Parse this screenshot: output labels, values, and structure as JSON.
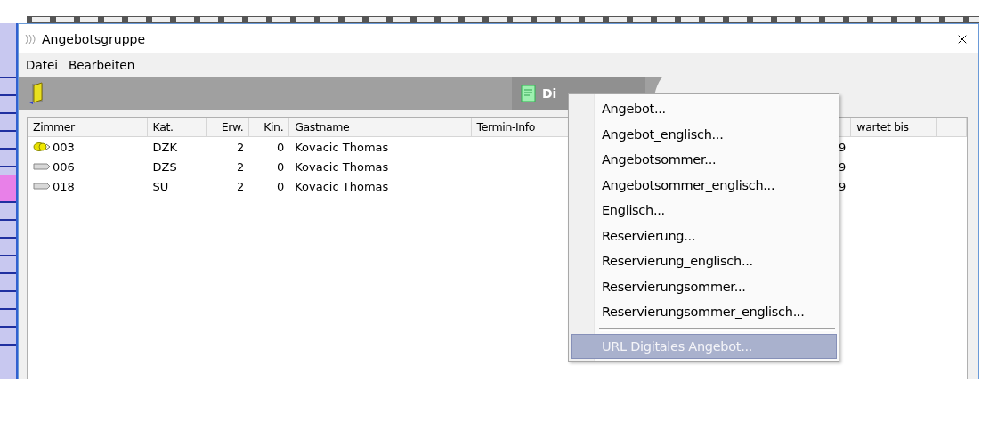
{
  "window": {
    "title": "Angebotsgruppe"
  },
  "menubar": [
    {
      "label": "Datei"
    },
    {
      "label": "Bearbeiten"
    }
  ],
  "toolbar": {
    "digi_button": {
      "label": "Di"
    }
  },
  "table": {
    "columns": [
      {
        "label": "Zimmer"
      },
      {
        "label": "Kat."
      },
      {
        "label": "Erw."
      },
      {
        "label": "Kin."
      },
      {
        "label": "Gastname"
      },
      {
        "label": "Termin-Info"
      },
      {},
      {
        "label": "wartet bis"
      },
      {}
    ],
    "rows": [
      {
        "marked": true,
        "cells": [
          "003",
          "DZK",
          "2",
          "0",
          "Kovacic Thomas",
          "",
          "9",
          "",
          ""
        ]
      },
      {
        "marked": false,
        "cells": [
          "006",
          "DZS",
          "2",
          "0",
          "Kovacic Thomas",
          "",
          "9",
          "",
          ""
        ]
      },
      {
        "marked": false,
        "cells": [
          "018",
          "SU",
          "2",
          "0",
          "Kovacic Thomas",
          "",
          "9",
          "",
          ""
        ]
      }
    ]
  },
  "context_menu": {
    "items": [
      {
        "kind": "item",
        "label": "Angebot...",
        "selected": false
      },
      {
        "kind": "item",
        "label": "Angebot_englisch...",
        "selected": false
      },
      {
        "kind": "item",
        "label": "Angebotsommer...",
        "selected": false
      },
      {
        "kind": "item",
        "label": "Angebotsommer_englisch...",
        "selected": false
      },
      {
        "kind": "item",
        "label": "Englisch...",
        "selected": false
      },
      {
        "kind": "item",
        "label": "Reservierung...",
        "selected": false
      },
      {
        "kind": "item",
        "label": "Reservierung_englisch...",
        "selected": false
      },
      {
        "kind": "item",
        "label": "Reservierungsommer...",
        "selected": false
      },
      {
        "kind": "item",
        "label": "Reservierungsommer_englisch...",
        "selected": false
      },
      {
        "kind": "separator"
      },
      {
        "kind": "item",
        "label": "URL Digitales Angebot...",
        "selected": true
      }
    ]
  }
}
